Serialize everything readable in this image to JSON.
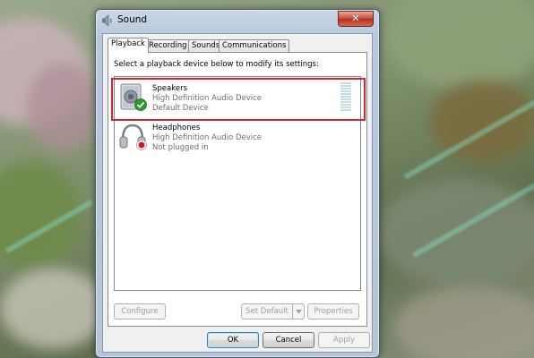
{
  "window": {
    "title": "Sound",
    "close_glyph": "✕"
  },
  "tabs": [
    {
      "label": "Playback",
      "active": true
    },
    {
      "label": "Recording",
      "active": false
    },
    {
      "label": "Sounds",
      "active": false
    },
    {
      "label": "Communications",
      "active": false
    }
  ],
  "playback": {
    "instruction": "Select a playback device below to modify its settings:",
    "devices": [
      {
        "name": "Speakers",
        "description": "High Definition Audio Device",
        "status": "Default Device",
        "icon": "speaker-icon",
        "badge": "default-check-icon",
        "selected": true
      },
      {
        "name": "Headphones",
        "description": "High Definition Audio Device",
        "status": "Not plugged in",
        "icon": "headphones-icon",
        "badge": "unplugged-icon",
        "selected": false
      }
    ],
    "buttons": {
      "configure": "Configure",
      "set_default": "Set Default",
      "properties": "Properties"
    }
  },
  "dialog_buttons": {
    "ok": "OK",
    "cancel": "Cancel",
    "apply": "Apply"
  },
  "colors": {
    "highlight": "#d8232a",
    "check_badge": "#2e9a2e",
    "unplugged_badge": "#d01818"
  }
}
